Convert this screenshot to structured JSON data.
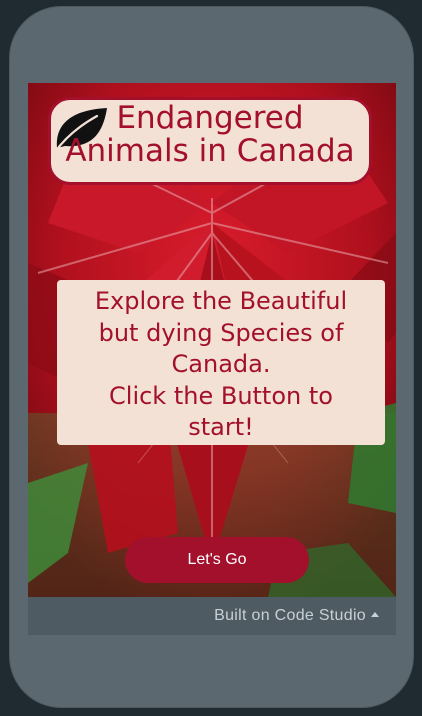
{
  "app": {
    "title": "Endangered\nAnimals in Canada",
    "description": "Explore the Beautiful\nbut dying Species of\nCanada.\nClick the Button to\nstart!",
    "start_button_label": "Let's Go"
  },
  "footer": {
    "label": "Built on Code Studio"
  },
  "icons": {
    "title_icon": "leaf-icon",
    "footer_icon": "caret-up-icon"
  },
  "colors": {
    "accent": "#a3102c",
    "card_background": "#f4e1d6",
    "device_frame": "#5b6870",
    "footer_bar": "#4f5b62"
  }
}
